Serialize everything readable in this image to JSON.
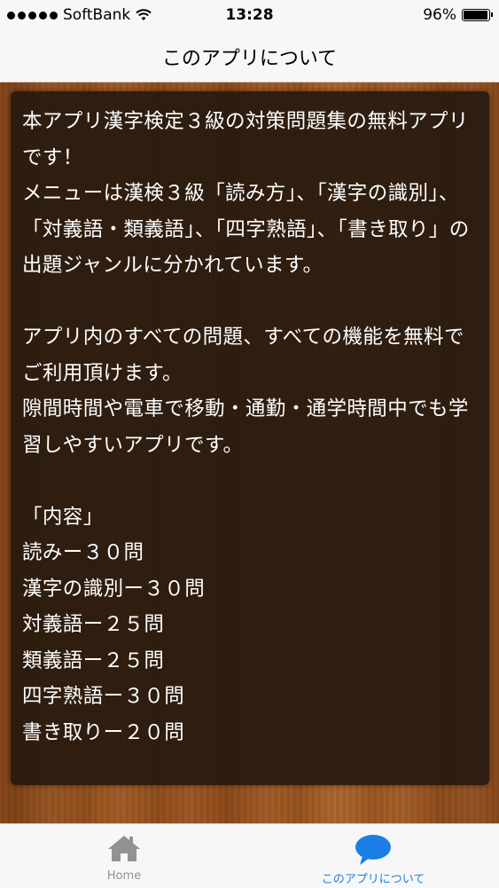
{
  "status_bar": {
    "carrier": "SoftBank",
    "time": "13:28",
    "battery": "96%",
    "battery_level": 0.96
  },
  "nav": {
    "title": "このアプリについて"
  },
  "content": {
    "text": "本アプリ漢字検定３級の対策問題集の無料アプリです！\nメニューは漢検３級「読み方」、「漢字の識別」、「対義語・類義語」、「四字熟語」、「書き取り」の出題ジャンルに分かれています。\n\nアプリ内のすべての問題、すべての機能を無料でご利用頂けます。\n隙間時間や電車で移動・通勤・通学時間中でも学習しやすいアプリです。\n\n「内容」\n読みー３０問\n漢字の識別ー３０問\n対義語ー２５問\n類義語ー２５問\n四字熟語ー３０問\n書き取りー２０問"
  },
  "tabs": [
    {
      "label": "Home",
      "icon": "home-icon",
      "selected": false
    },
    {
      "label": "このアプリについて",
      "icon": "speech-bubble-icon",
      "selected": true
    }
  ],
  "colors": {
    "accent": "#1a7ee5",
    "tab_inactive": "#929292",
    "panel": "#24180e",
    "wood": "#a35b24"
  }
}
